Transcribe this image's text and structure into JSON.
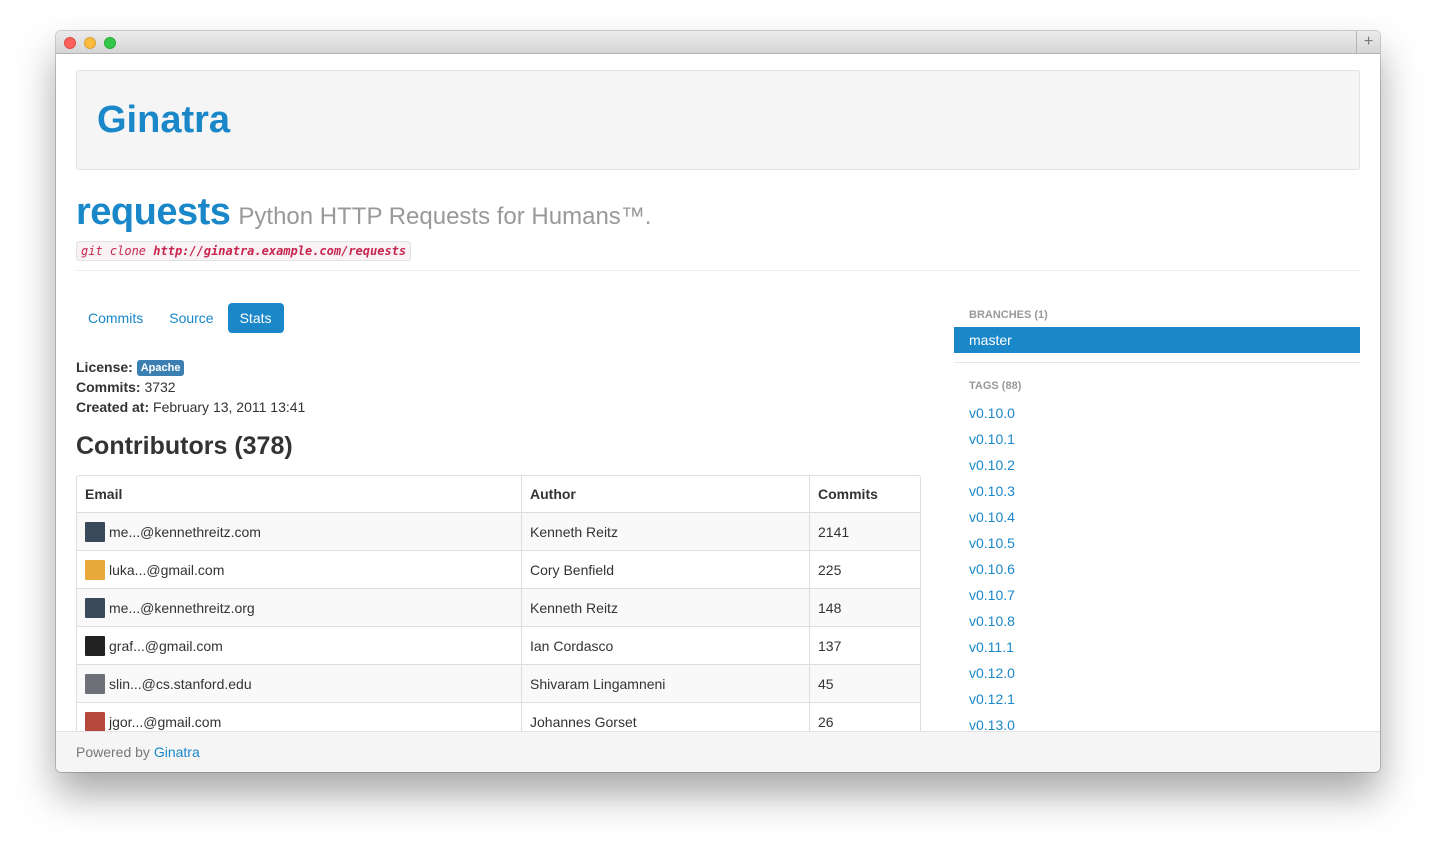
{
  "brand": "Ginatra",
  "repo": {
    "name": "requests",
    "description": "Python HTTP Requests for Humans™.",
    "clone_prefix": "git clone",
    "clone_url": "http://ginatra.example.com/requests"
  },
  "tabs": [
    {
      "label": "Commits",
      "active": false
    },
    {
      "label": "Source",
      "active": false
    },
    {
      "label": "Stats",
      "active": true
    }
  ],
  "stats": {
    "license_label": "License:",
    "license_value": "Apache",
    "commits_label": "Commits:",
    "commits_value": "3732",
    "created_label": "Created at:",
    "created_value": "February 13, 2011 13:41"
  },
  "contributors": {
    "title": "Contributors (378)",
    "headers": [
      "Email",
      "Author",
      "Commits"
    ],
    "rows": [
      {
        "email": "me...@kennethreitz.com",
        "author": "Kenneth Reitz",
        "commits": "2141",
        "avatar_color": "#3b4a5a"
      },
      {
        "email": "luka...@gmail.com",
        "author": "Cory Benfield",
        "commits": "225",
        "avatar_color": "#e8a93a"
      },
      {
        "email": "me...@kennethreitz.org",
        "author": "Kenneth Reitz",
        "commits": "148",
        "avatar_color": "#3b4a5a"
      },
      {
        "email": "graf...@gmail.com",
        "author": "Ian Cordasco",
        "commits": "137",
        "avatar_color": "#222222"
      },
      {
        "email": "slin...@cs.stanford.edu",
        "author": "Shivaram Lingamneni",
        "commits": "45",
        "avatar_color": "#6c6f75"
      },
      {
        "email": "jgor...@gmail.com",
        "author": "Johannes Gorset",
        "commits": "26",
        "avatar_color": "#b5483a"
      }
    ]
  },
  "sidebar": {
    "branches_header": "BRANCHES (1)",
    "branches": [
      "master"
    ],
    "tags_header": "TAGS (88)",
    "tags": [
      "v0.10.0",
      "v0.10.1",
      "v0.10.2",
      "v0.10.3",
      "v0.10.4",
      "v0.10.5",
      "v0.10.6",
      "v0.10.7",
      "v0.10.8",
      "v0.11.1",
      "v0.12.0",
      "v0.12.1",
      "v0.13.0"
    ]
  },
  "footer": {
    "prefix": "Powered by",
    "link": "Ginatra"
  },
  "colors": {
    "accent": "#1a87c9",
    "badge": "#3c7fb2",
    "code": "#c7254e"
  }
}
